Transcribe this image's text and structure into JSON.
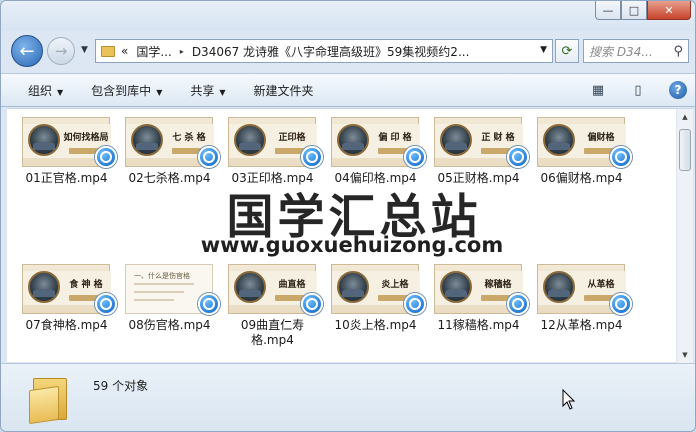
{
  "window": {
    "buttons": {
      "minimize": "—",
      "maximize": "□",
      "close": "✕"
    }
  },
  "nav": {
    "back_icon": "←",
    "forward_icon": "→",
    "history_dropdown": "▼",
    "address": {
      "prefix": "«",
      "segments": [
        "国学...",
        "D34067 龙诗雅《八字命理高级班》59集视频约2..."
      ],
      "separator": "▸"
    },
    "refresh_icon": "⟳",
    "search_placeholder": "搜索 D34...",
    "search_icon": "⚲"
  },
  "toolbar": {
    "organize": "组织",
    "include_in_library": "包含到库中",
    "share": "共享",
    "new_folder": "新建文件夹",
    "view_icon": "▦",
    "preview_pane_icon": "▯",
    "help": "?"
  },
  "files": [
    {
      "name": "01正官格.mp4",
      "thumb_title": "如何找格局"
    },
    {
      "name": "02七杀格.mp4",
      "thumb_title": "七 杀 格"
    },
    {
      "name": "03正印格.mp4",
      "thumb_title": "正印格"
    },
    {
      "name": "04偏印格.mp4",
      "thumb_title": "偏 印 格"
    },
    {
      "name": "05正财格.mp4",
      "thumb_title": "正 财 格"
    },
    {
      "name": "06偏财格.mp4",
      "thumb_title": "偏财格"
    },
    {
      "name": "07食神格.mp4",
      "thumb_title": "食 神 格"
    },
    {
      "name": "08伤官格.mp4",
      "thumb_title": "一、什么是伤官格"
    },
    {
      "name": "09曲直仁寿格.mp4",
      "thumb_title": "曲直格"
    },
    {
      "name": "10炎上格.mp4",
      "thumb_title": "炎上格"
    },
    {
      "name": "11稼穑格.mp4",
      "thumb_title": "稼穑格"
    },
    {
      "name": "12从革格.mp4",
      "thumb_title": "从革格"
    }
  ],
  "watermark": {
    "chinese": "国学汇总站",
    "url": "www.guoxuehuizong.com"
  },
  "status": {
    "count": "59 个对象"
  }
}
